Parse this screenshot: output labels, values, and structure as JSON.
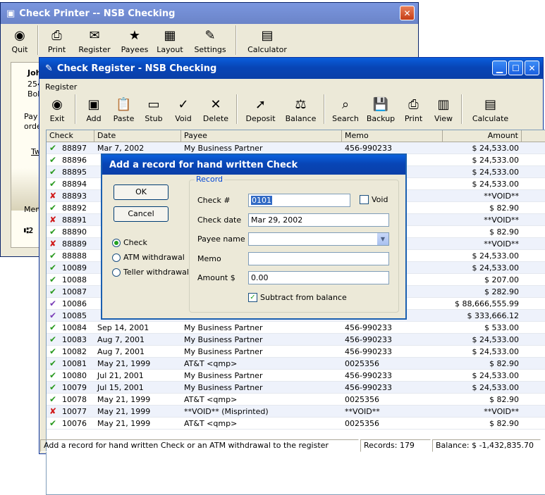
{
  "back_window": {
    "title": "Check Printer -- NSB Checking",
    "toolbar": [
      {
        "label": "Quit",
        "icon": "quit-icon",
        "glyph": "◉"
      },
      {
        "label": "Print",
        "icon": "printer-icon",
        "glyph": "⎙"
      },
      {
        "label": "Register",
        "icon": "register-icon",
        "glyph": "✉"
      },
      {
        "label": "Payees",
        "icon": "star-icon",
        "glyph": "★"
      },
      {
        "label": "Layout",
        "icon": "layout-icon",
        "glyph": "▦"
      },
      {
        "label": "Settings",
        "icon": "settings-icon",
        "glyph": "✎"
      },
      {
        "label": "Calculator",
        "icon": "calculator-icon",
        "glyph": "▤"
      }
    ],
    "partial": {
      "name": "Joh",
      "addr1": "254",
      "addr2": "Boli",
      "pay1": "Pay",
      "pay2": "orde",
      "tw": "Tw",
      "memo": "Mem",
      "micr": "⑆2"
    }
  },
  "register_window": {
    "title": "Check Register - NSB Checking",
    "menu": [
      "Register"
    ],
    "toolbar": [
      {
        "label": "Exit",
        "icon": "exit-icon",
        "glyph": "◉"
      },
      {
        "label": "Add",
        "icon": "add-icon",
        "glyph": "▣"
      },
      {
        "label": "Paste",
        "icon": "paste-icon",
        "glyph": "📋"
      },
      {
        "label": "Stub",
        "icon": "stub-icon",
        "glyph": "▭"
      },
      {
        "label": "Void",
        "icon": "void-icon",
        "glyph": "✓"
      },
      {
        "label": "Delete",
        "icon": "delete-icon",
        "glyph": "✕"
      },
      {
        "label": "Deposit",
        "icon": "deposit-icon",
        "glyph": "➚"
      },
      {
        "label": "Balance",
        "icon": "balance-icon",
        "glyph": "⚖"
      },
      {
        "label": "Search",
        "icon": "search-icon",
        "glyph": "⌕"
      },
      {
        "label": "Backup",
        "icon": "backup-icon",
        "glyph": "💾"
      },
      {
        "label": "Print",
        "icon": "printer-icon",
        "glyph": "⎙"
      },
      {
        "label": "View",
        "icon": "view-icon",
        "glyph": "▥"
      },
      {
        "label": "Calculate",
        "icon": "calculator-icon",
        "glyph": "▤"
      }
    ],
    "columns": [
      "Check",
      "Date",
      "Payee",
      "Memo",
      "Amount"
    ],
    "rows": [
      {
        "status": "ok",
        "check": "88897",
        "date": "Mar 7, 2002",
        "payee": "My Business Partner",
        "memo": "456-990233",
        "amount": "$ 24,533.00"
      },
      {
        "status": "ok",
        "check": "88896",
        "date": "",
        "payee": "",
        "memo": "",
        "amount": "$ 24,533.00"
      },
      {
        "status": "ok",
        "check": "88895",
        "date": "",
        "payee": "",
        "memo": "",
        "amount": "$ 24,533.00"
      },
      {
        "status": "ok",
        "check": "88894",
        "date": "",
        "payee": "",
        "memo": "",
        "amount": "$ 24,533.00"
      },
      {
        "status": "x",
        "check": "88893",
        "date": "",
        "payee": "",
        "memo": "",
        "amount": "**VOID**"
      },
      {
        "status": "ok",
        "check": "88892",
        "date": "",
        "payee": "",
        "memo": "",
        "amount": "$ 82.90"
      },
      {
        "status": "x",
        "check": "88891",
        "date": "",
        "payee": "",
        "memo": "",
        "amount": "**VOID**"
      },
      {
        "status": "ok",
        "check": "88890",
        "date": "",
        "payee": "",
        "memo": "",
        "amount": "$ 82.90"
      },
      {
        "status": "x",
        "check": "88889",
        "date": "",
        "payee": "",
        "memo": "",
        "amount": "**VOID**"
      },
      {
        "status": "ok",
        "check": "88888",
        "date": "",
        "payee": "",
        "memo": "",
        "amount": "$ 24,533.00"
      },
      {
        "status": "ok",
        "check": "10089",
        "date": "",
        "payee": "",
        "memo": "",
        "amount": "$ 24,533.00"
      },
      {
        "status": "ok",
        "check": "10088",
        "date": "",
        "payee": "",
        "memo": "",
        "amount": "$ 207.00"
      },
      {
        "status": "ok",
        "check": "10087",
        "date": "",
        "payee": "",
        "memo": "",
        "amount": "$ 282.90"
      },
      {
        "status": "v",
        "check": "10086",
        "date": "",
        "payee": "",
        "memo": "",
        "amount": "$ 88,666,555.99"
      },
      {
        "status": "v",
        "check": "10085",
        "date": "",
        "payee": "",
        "memo": "",
        "amount": "$ 333,666.12"
      },
      {
        "status": "ok",
        "check": "10084",
        "date": "Sep 14, 2001",
        "payee": "My Business Partner",
        "memo": "456-990233",
        "amount": "$ 533.00"
      },
      {
        "status": "ok",
        "check": "10083",
        "date": "Aug 7, 2001",
        "payee": "My Business Partner",
        "memo": "456-990233",
        "amount": "$ 24,533.00"
      },
      {
        "status": "ok",
        "check": "10082",
        "date": "Aug 7, 2001",
        "payee": "My Business Partner",
        "memo": "456-990233",
        "amount": "$ 24,533.00"
      },
      {
        "status": "ok",
        "check": "10081",
        "date": "May 21, 1999",
        "payee": "AT&T  <qmp>",
        "memo": "0025356",
        "amount": "$ 82.90"
      },
      {
        "status": "ok",
        "check": "10080",
        "date": "Jul 21, 2001",
        "payee": "My Business Partner",
        "memo": "456-990233",
        "amount": "$ 24,533.00"
      },
      {
        "status": "ok",
        "check": "10079",
        "date": "Jul 15, 2001",
        "payee": "My Business Partner",
        "memo": "456-990233",
        "amount": "$ 24,533.00"
      },
      {
        "status": "ok",
        "check": "10078",
        "date": "May 21, 1999",
        "payee": "AT&T  <qmp>",
        "memo": "0025356",
        "amount": "$ 82.90"
      },
      {
        "status": "x",
        "check": "10077",
        "date": "May 21, 1999",
        "payee": "**VOID** (Misprinted)",
        "memo": "**VOID**",
        "amount": "**VOID**"
      },
      {
        "status": "ok",
        "check": "10076",
        "date": "May 21, 1999",
        "payee": "AT&T  <qmp>",
        "memo": "0025356",
        "amount": "$ 82.90"
      }
    ],
    "status_bar": {
      "message": "Add a record for hand written Check or an ATM withdrawal to the register",
      "records": "Records: 179",
      "balance": "Balance: $ -1,432,835.70"
    }
  },
  "dialog": {
    "title": "Add a record for hand written Check",
    "ok_label": "OK",
    "cancel_label": "Cancel",
    "radios": [
      {
        "label": "Check",
        "selected": true
      },
      {
        "label": "ATM withdrawal",
        "selected": false
      },
      {
        "label": "Teller withdrawal",
        "selected": false
      }
    ],
    "group_title": "Record",
    "check_label": "Check #",
    "check_value": "0101",
    "void_label": "Void",
    "date_label": "Check date",
    "date_value": "Mar 29, 2002",
    "payee_label": "Payee name",
    "payee_value": "",
    "memo_label": "Memo",
    "memo_value": "",
    "amount_label": "Amount $",
    "amount_value": "0.00",
    "subtract_label": "Subtract from balance"
  },
  "colors": {
    "titlebar": "#0a4fc8",
    "check_ok": "#2a9a20",
    "check_void": "#d01818",
    "check_cleared": "#7a3db8"
  }
}
